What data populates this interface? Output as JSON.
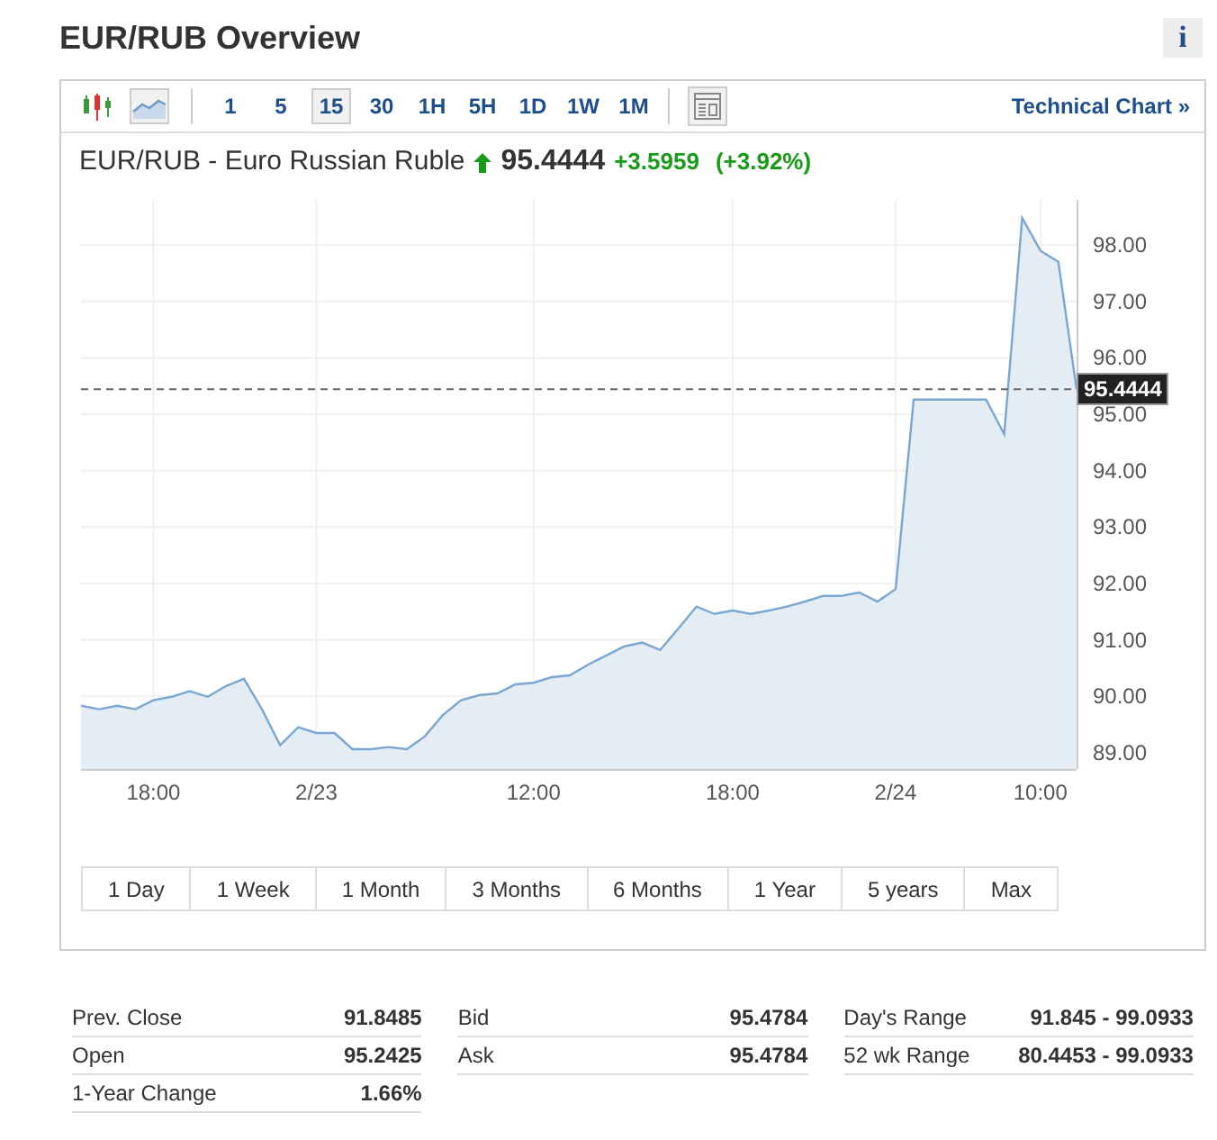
{
  "header": {
    "title": "EUR/RUB Overview",
    "info_button": "i"
  },
  "toolbar": {
    "chart_types": [
      {
        "kind": "candlestick",
        "selected": false
      },
      {
        "kind": "area",
        "selected": true
      }
    ],
    "intervals": [
      {
        "label": "1",
        "selected": false
      },
      {
        "label": "5",
        "selected": false
      },
      {
        "label": "15",
        "selected": true
      },
      {
        "label": "30",
        "selected": false
      },
      {
        "label": "1H",
        "selected": false
      },
      {
        "label": "5H",
        "selected": false
      },
      {
        "label": "1D",
        "selected": false
      },
      {
        "label": "1W",
        "selected": false
      },
      {
        "label": "1M",
        "selected": false
      }
    ],
    "technical_chart_link": "Technical Chart »"
  },
  "quote": {
    "name": "EUR/RUB - Euro Russian Ruble",
    "price": "95.4444",
    "change": "+3.5959",
    "change_percent": "(+3.92%)"
  },
  "chart": {
    "chart_data": {
      "type": "area",
      "categories": [
        null,
        null,
        null,
        null,
        "18:00",
        null,
        null,
        null,
        null,
        null,
        null,
        null,
        null,
        "2/23",
        null,
        null,
        null,
        null,
        null,
        null,
        null,
        null,
        null,
        null,
        null,
        "12:00",
        null,
        null,
        null,
        null,
        null,
        null,
        null,
        null,
        null,
        null,
        "18:00",
        null,
        null,
        null,
        null,
        null,
        null,
        null,
        null,
        "2/24",
        null,
        null,
        null,
        null,
        null,
        null,
        null,
        "10:00",
        null,
        null
      ],
      "series": [
        {
          "color": "#7aa7d2",
          "values": [
            89.83,
            89.77,
            89.83,
            89.77,
            89.93,
            89.99,
            90.09,
            89.99,
            90.18,
            90.31,
            89.77,
            89.13,
            89.45,
            89.35,
            89.35,
            89.06,
            89.06,
            89.1,
            89.06,
            89.29,
            89.67,
            89.93,
            90.02,
            90.05,
            90.21,
            90.24,
            90.34,
            90.37,
            90.56,
            90.72,
            90.88,
            90.95,
            90.82,
            91.2,
            91.59,
            91.46,
            91.52,
            91.46,
            91.52,
            91.59,
            91.68,
            91.78,
            91.78,
            91.84,
            91.68,
            91.9,
            95.26,
            95.26,
            95.26,
            95.26,
            95.26,
            94.65,
            98.48,
            97.9,
            97.7,
            95.44
          ]
        }
      ],
      "ylim": [
        88.71,
        98.8
      ],
      "yticks": [
        {
          "value": 89,
          "label": "89.00"
        },
        {
          "value": 90,
          "label": "90.00"
        },
        {
          "value": 91,
          "label": "91.00"
        },
        {
          "value": 92,
          "label": "92.00"
        },
        {
          "value": 93,
          "label": "93.00"
        },
        {
          "value": 94,
          "label": "94.00"
        },
        {
          "value": 95,
          "label": "95.00"
        },
        {
          "value": 96,
          "label": "96.00"
        },
        {
          "value": 97,
          "label": "97.00"
        },
        {
          "value": 98,
          "label": "98.00"
        }
      ],
      "grid": true,
      "ref_lines": [
        {
          "axis": "y",
          "value": 95.4444,
          "label": "95.4444"
        }
      ]
    }
  },
  "ranges": [
    {
      "label": "1 Day",
      "selected": false
    },
    {
      "label": "1 Week",
      "selected": false
    },
    {
      "label": "1 Month",
      "selected": false
    },
    {
      "label": "3 Months",
      "selected": false
    },
    {
      "label": "6 Months",
      "selected": false
    },
    {
      "label": "1 Year",
      "selected": false
    },
    {
      "label": "5 years",
      "selected": false
    },
    {
      "label": "Max",
      "selected": false
    }
  ],
  "stats": {
    "columns": [
      [
        {
          "label": "Prev. Close",
          "value": "91.8485"
        },
        {
          "label": "Open",
          "value": "95.2425"
        },
        {
          "label": "1-Year Change",
          "value": "1.66%"
        }
      ],
      [
        {
          "label": "Bid",
          "value": "95.4784"
        },
        {
          "label": "Ask",
          "value": "95.4784"
        }
      ],
      [
        {
          "label": "Day's Range",
          "value": "91.845 - 99.0933"
        },
        {
          "label": "52 wk Range",
          "value": "80.4453 - 99.0933"
        }
      ]
    ]
  }
}
